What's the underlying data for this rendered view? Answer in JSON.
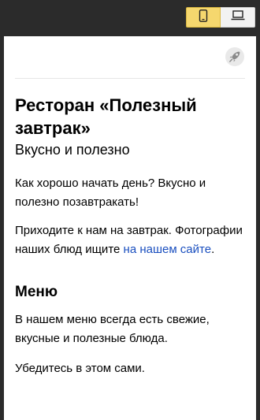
{
  "toolbar": {
    "mobile_icon": "mobile-phone-icon",
    "desktop_icon": "laptop-icon",
    "active_color": "#f5d76e"
  },
  "page": {
    "header_icon": "rocket-icon",
    "title": "Ресторан «Полезный завтрак»",
    "subtitle": "Вкусно и полезно",
    "intro": "Как хорошо начать день? Вкусно и полезно позавтракать!",
    "visit_text": "Приходите к нам на завтрак. Фотографии наших блюд ищите ",
    "visit_link": "на нашем сайте",
    "visit_end": ".",
    "menu_heading": "Меню",
    "menu_text": "В нашем меню всегда есть свежие, вкусные и полезные блюда.",
    "menu_cta": "Убедитесь в этом сами.",
    "link_color": "#1a4fbf"
  }
}
